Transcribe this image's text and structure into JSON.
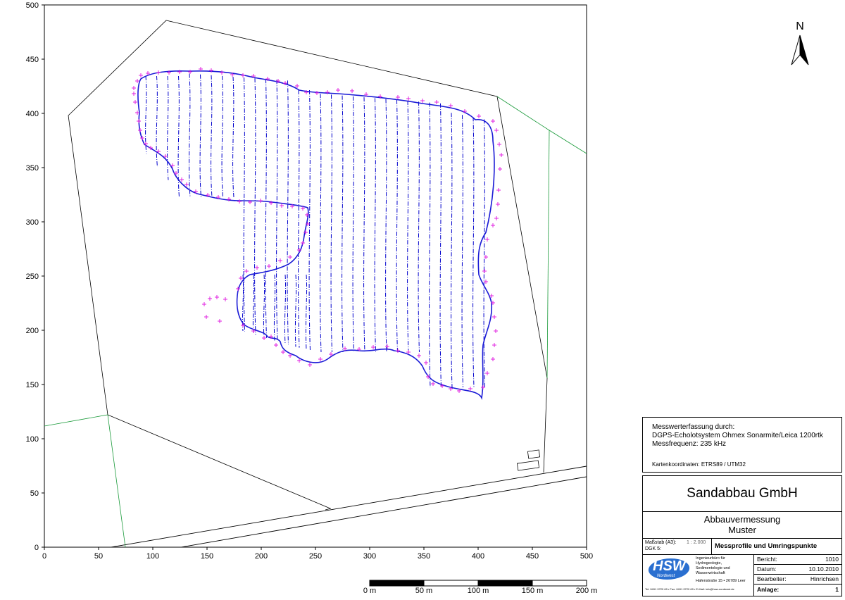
{
  "map": {
    "x_axis_ticks": [
      "0",
      "50",
      "100",
      "150",
      "200",
      "250",
      "300",
      "350",
      "400",
      "450",
      "500"
    ],
    "y_axis_ticks": [
      "0",
      "50",
      "100",
      "150",
      "200",
      "250",
      "300",
      "350",
      "400",
      "450",
      "500"
    ],
    "xlim": [
      0,
      500
    ],
    "ylim": [
      0,
      500
    ],
    "north_label": "N",
    "colors": {
      "profile_lines": "#0000cc",
      "boundary": "#1a1ad6",
      "points": "#e020e0",
      "parcels": "#000000",
      "green_lines": "#1a9a3a"
    },
    "scale_bar": {
      "labels": [
        "0 m",
        "50 m",
        "100 m",
        "150 m",
        "200 m"
      ]
    }
  },
  "info_box": {
    "title": "Messwerterfassung durch:",
    "line1": "DGPS-Echolotsystem Ohmex Sonarmite/Leica 1200rtk",
    "line2": "Messfrequenz: 235 kHz",
    "coords": "Kartenkoordinaten: ETRS89 / UTM32"
  },
  "title_block": {
    "company": "Sandabbau GmbH",
    "project_line1": "Abbauvermessung",
    "project_line2": "Muster",
    "scale_label": "Maßstab (A3):",
    "scale_value": "1 : 2.000",
    "dgk_label": "DGK 5:",
    "drawing_title": "Messprofile und Umringspunkte",
    "logo_text": "HSW",
    "logo_sub": "Nordwest",
    "firm_line1": "Ingenieurbüro für",
    "firm_line2": "Hydrogeologie,",
    "firm_line3": "Sedimentologie und",
    "firm_line4": "Wasserwirtschaft",
    "firm_address": "Hafenstraße 15 • 26789 Leer",
    "firm_contact": "Tel: 0491 9729 69 • Fax: 0491 9729 69 • E-Mail: info@hsw-nordwest.de",
    "bericht_label": "Bericht:",
    "bericht_value": "1010",
    "datum_label": "Datum:",
    "datum_value": "10.10.2010",
    "bearbeiter_label": "Bearbeiter:",
    "bearbeiter_value": "Hinrichsen",
    "anlage_label": "Anlage:",
    "anlage_value": "1"
  }
}
